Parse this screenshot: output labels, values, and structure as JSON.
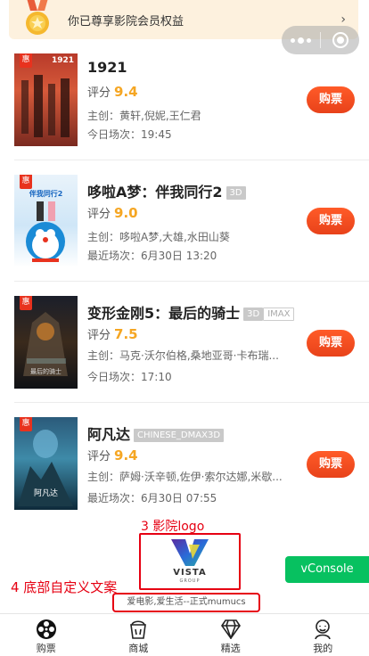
{
  "banner": {
    "text": "你已尊享影院会员权益",
    "arrow": "›"
  },
  "movies": [
    {
      "title": "1921",
      "formats": [],
      "score_label": "评分",
      "score": "9.4",
      "cast": "主创：黄轩,倪妮,王仁君",
      "showtime": "今日场次：19:45",
      "buy_label": "购票",
      "tag": "惠",
      "poster_text": "1921"
    },
    {
      "title": "哆啦A梦：伴我同行2",
      "formats": [
        "3D"
      ],
      "score_label": "评分",
      "score": "9.0",
      "cast": "主创：哆啦A梦,大雄,水田山葵",
      "showtime": "最近场次：6月30日 13:20",
      "buy_label": "购票",
      "tag": "惠",
      "poster_text": "伴我同行2"
    },
    {
      "title": "变形金刚5：最后的骑士",
      "formats": [
        "3D",
        "IMAX"
      ],
      "score_label": "评分",
      "score": "7.5",
      "cast": "主创：马克·沃尔伯格,桑地亚哥·卡布瑞...",
      "showtime": "今日场次：17:10",
      "buy_label": "购票",
      "tag": "惠",
      "poster_text": "最后的骑士"
    },
    {
      "title": "阿凡达",
      "formats": [
        "CHINESE_DMAX3D"
      ],
      "score_label": "评分",
      "score": "9.4",
      "cast": "主创：萨姆·沃辛顿,佐伊·索尔达娜,米歇...",
      "showtime": "最近场次：6月30日 07:55",
      "buy_label": "购票",
      "tag": "惠",
      "poster_text": "阿凡达"
    }
  ],
  "annotations": {
    "logo_note": "3 影院logo",
    "footer_note": "4 底部自定义文案"
  },
  "cinema_logo": {
    "brand": "VISTA",
    "sub": "GROUP"
  },
  "footer_slogan": "爱电影,爱生活--正式mumucs",
  "vconsole": "vConsole",
  "tabbar": [
    {
      "label": "购票",
      "icon": "film-reel-icon"
    },
    {
      "label": "商城",
      "icon": "cup-icon"
    },
    {
      "label": "精选",
      "icon": "diamond-icon"
    },
    {
      "label": "我的",
      "icon": "user-icon"
    }
  ],
  "colors": {
    "accent": "#f5a623",
    "buy": "#e8421a",
    "annotation": "#e60012",
    "vconsole": "#07c160",
    "banner": "#fdf1de"
  }
}
